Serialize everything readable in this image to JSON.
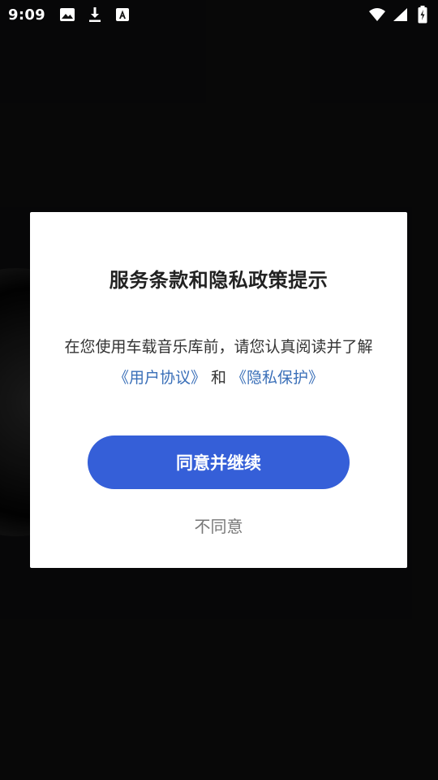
{
  "status_bar": {
    "time": "9:09",
    "left_icons": [
      "image-icon",
      "download-icon",
      "font-a-icon"
    ],
    "right_icons": [
      "wifi-icon",
      "signal-icon",
      "battery-charging-icon"
    ]
  },
  "dialog": {
    "title": "服务条款和隐私政策提示",
    "body_text": "在您使用车载音乐库前，请您认真阅读并了解",
    "user_agreement_link": "《用户协议》",
    "joiner": "和",
    "privacy_link": "《隐私保护》",
    "agree_label": "同意并继续",
    "disagree_label": "不同意"
  },
  "colors": {
    "accent": "#355fd8",
    "link": "#3a6fb8",
    "background": "#111112"
  }
}
